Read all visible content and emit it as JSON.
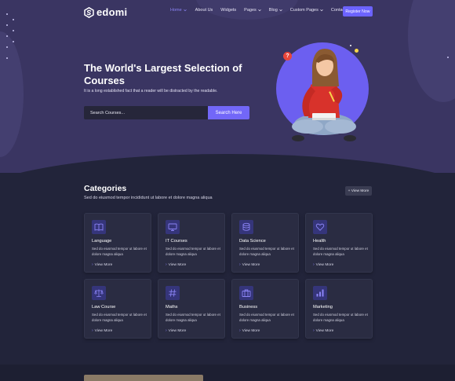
{
  "brand": {
    "name": "edomi"
  },
  "nav": {
    "items": [
      {
        "label": "Home",
        "has_dropdown": true,
        "active": true
      },
      {
        "label": "About Us",
        "has_dropdown": false,
        "active": false
      },
      {
        "label": "Widgets",
        "has_dropdown": false,
        "active": false
      },
      {
        "label": "Pages",
        "has_dropdown": true,
        "active": false
      },
      {
        "label": "Blog",
        "has_dropdown": true,
        "active": false
      },
      {
        "label": "Custom Pages",
        "has_dropdown": true,
        "active": false
      },
      {
        "label": "Contact Us",
        "has_dropdown": false,
        "active": false
      }
    ],
    "register_label": "Register Now"
  },
  "hero": {
    "title": "The World's Largest Selection of Courses",
    "subtitle": "It is a long established fact that a reader will be distracted by the readable.",
    "search_placeholder": "Search Courses...",
    "search_button": "Search Here",
    "badge": "?"
  },
  "categories": {
    "title": "Categories",
    "subtitle": "Sed do eiusmod tempor incididunt ut labore et dolore magna aliqua",
    "view_more_label": "+ View More",
    "items": [
      {
        "title": "Language",
        "desc": "Sed do eiusmod tempor ut labore et dolore magna aliqua",
        "link": "View More",
        "icon": "book-icon"
      },
      {
        "title": "IT Courses",
        "desc": "Sed do eiusmod tempor ut labore et dolore magna aliqua",
        "link": "View More",
        "icon": "monitor-icon"
      },
      {
        "title": "Data Science",
        "desc": "Sed do eiusmod tempor ut labore et dolore magna aliqua",
        "link": "View More",
        "icon": "database-icon"
      },
      {
        "title": "Health",
        "desc": "Sed do eiusmod tempor ut labore et dolore magna aliqua",
        "link": "View More",
        "icon": "heart-icon"
      },
      {
        "title": "Law Course",
        "desc": "Sed do eiusmod tempor ut labore et dolore magna aliqua",
        "link": "View More",
        "icon": "scale-icon"
      },
      {
        "title": "Maths",
        "desc": "Sed do eiusmod tempor ut labore et dolore magna aliqua",
        "link": "View More",
        "icon": "hash-icon"
      },
      {
        "title": "Business",
        "desc": "Sed do eiusmod tempor ut labore et dolore magna aliqua",
        "link": "View More",
        "icon": "briefcase-icon"
      },
      {
        "title": "Marketing",
        "desc": "Sed do eiusmod tempor ut labore et dolore magna aliqua",
        "link": "View More",
        "icon": "bar-chart-icon"
      }
    ]
  },
  "colors": {
    "accent": "#6c63ff",
    "hero_bg": "#3a3562",
    "page_bg": "#22243a",
    "card_bg": "#2a2c42",
    "badge_red": "#e8463b"
  }
}
